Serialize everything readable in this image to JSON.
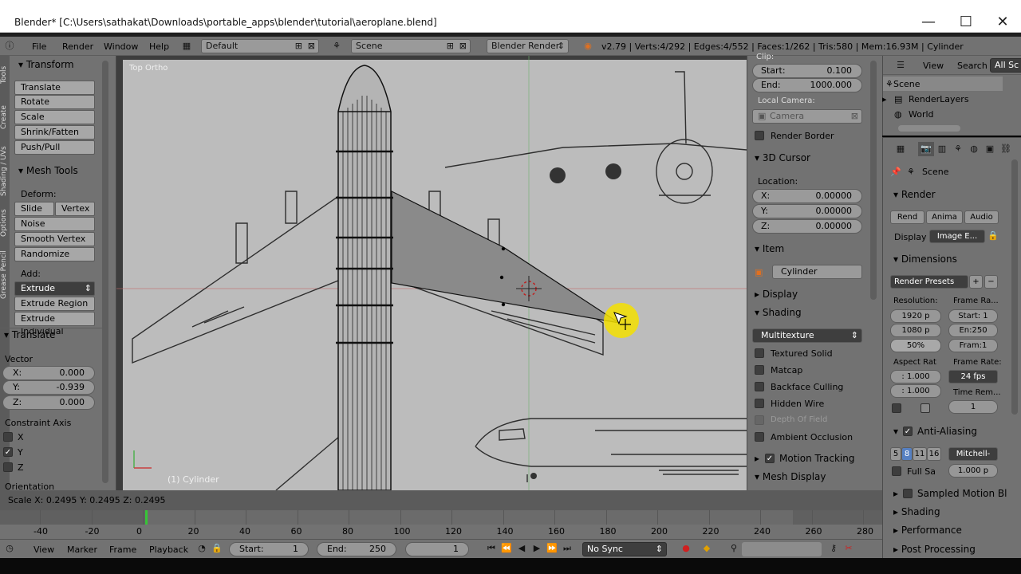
{
  "window": {
    "title": "Blender* [C:\\Users\\sathakat\\Downloads\\portable_apps\\blender\\tutorial\\aeroplane.blend]",
    "minimize": "—",
    "maximize": "☐",
    "close": "✕"
  },
  "infobar": {
    "menus": [
      "File",
      "Render",
      "Window",
      "Help"
    ],
    "layout": "Default",
    "scene": "Scene",
    "engine": "Blender Render",
    "stats": "v2.79 | Verts:4/292 | Edges:4/552 | Faces:1/262 | Tris:580 | Mem:16.93M | Cylinder"
  },
  "left_tabs": [
    "Tools",
    "Create",
    "Shading / UVs",
    "Options",
    "Grease Pencil"
  ],
  "tool_panel": {
    "transform_header": "Transform",
    "transform_buttons": [
      "Translate",
      "Rotate",
      "Scale",
      "Shrink/Fatten",
      "Push/Pull"
    ],
    "mesh_tools_header": "Mesh Tools",
    "deform_label": "Deform:",
    "slide_edge": "Slide Ed",
    "vertex": "Vertex",
    "deform_buttons": [
      "Noise",
      "Smooth Vertex",
      "Randomize"
    ],
    "add_label": "Add:",
    "extrude": "Extrude",
    "add_buttons": [
      "Extrude Region",
      "Extrude Individual"
    ],
    "operator_header": "Translate",
    "vector_label": "Vector",
    "x_label": "X:",
    "x_value": "0.000",
    "y_label": "Y:",
    "y_value": "-0.939",
    "z_label": "Z:",
    "z_value": "0.000",
    "constraint_label": "Constraint Axis",
    "axis_x": "X",
    "axis_y": "Y",
    "axis_z": "Z",
    "orientation_label": "Orientation"
  },
  "viewport": {
    "view_name": "Top Ortho",
    "object_label": "(1) Cylinder"
  },
  "n_panel": {
    "clip_label": "Clip:",
    "start_label": "Start:",
    "start_value": "0.100",
    "end_label": "End:",
    "end_value": "1000.000",
    "local_camera_label": "Local Camera:",
    "camera": "Camera",
    "render_border": "Render Border",
    "cursor_header": "3D Cursor",
    "location_label": "Location:",
    "cx_label": "X:",
    "cx_value": "0.00000",
    "cy_label": "Y:",
    "cy_value": "0.00000",
    "cz_label": "Z:",
    "cz_value": "0.00000",
    "item_header": "Item",
    "item_name": "Cylinder",
    "display_header": "Display",
    "shading_header": "Shading",
    "shading_mode": "Multitexture",
    "shading_options": [
      "Textured Solid",
      "Matcap",
      "Backface Culling",
      "Hidden Wire",
      "Depth Of Field",
      "Ambient Occlusion"
    ],
    "motion_tracking": "Motion Tracking",
    "mesh_display": "Mesh Display"
  },
  "outliner": {
    "view": "View",
    "search": "Search",
    "all_scenes": "All Sc",
    "items": [
      "Scene",
      "RenderLayers",
      "World"
    ]
  },
  "properties": {
    "context": "Scene",
    "render_header": "Render",
    "render_btn": "Rend",
    "anim_btn": "Anima",
    "audio_btn": "Audio",
    "display_label": "Display",
    "display_value": "Image E...",
    "dimensions_header": "Dimensions",
    "render_presets": "Render Presets",
    "resolution_label": "Resolution:",
    "frame_range_label": "Frame Ra...",
    "res_x": "1920 p",
    "res_y": "1080 p",
    "res_pct": "50%",
    "frame_start": "Start: 1",
    "frame_end": "En:250",
    "frame_step": "Fram:1",
    "aspect_label": "Aspect Rat",
    "frame_rate_label": "Frame Rate:",
    "aspect_x": ": 1.000",
    "aspect_y": ": 1.000",
    "fps": "24 fps",
    "time_remap": "Time Rem...",
    "remap_val": "1",
    "aa_header": "Anti-Aliasing",
    "aa_samples": [
      "5",
      "8",
      "11",
      "16"
    ],
    "aa_filter": "Mitchell-",
    "full_sample": "Full Sa",
    "filter_size": "1.000 p",
    "sampled_motion": "Sampled Motion Bl",
    "shading": "Shading",
    "performance": "Performance",
    "post_processing": "Post Processing"
  },
  "status": {
    "text": "Scale X: 0.2495   Y: 0.2495   Z: 0.2495"
  },
  "timeline": {
    "ticks": [
      "-40",
      "-20",
      "0",
      "20",
      "40",
      "60",
      "80",
      "100",
      "120",
      "140",
      "160",
      "180",
      "200",
      "220",
      "240",
      "260",
      "280"
    ],
    "menus": [
      "View",
      "Marker",
      "Frame",
      "Playback"
    ],
    "start_label": "Start:",
    "start_value": "1",
    "end_label": "End:",
    "end_value": "250",
    "current_frame": "1",
    "sync": "No Sync"
  },
  "colors": {
    "panel": "#727272",
    "viewport": "#3d3d3d",
    "face_select": "#8a8a8a",
    "cursor_highlight": "#f5e000",
    "timeline_current": "#37c537"
  }
}
